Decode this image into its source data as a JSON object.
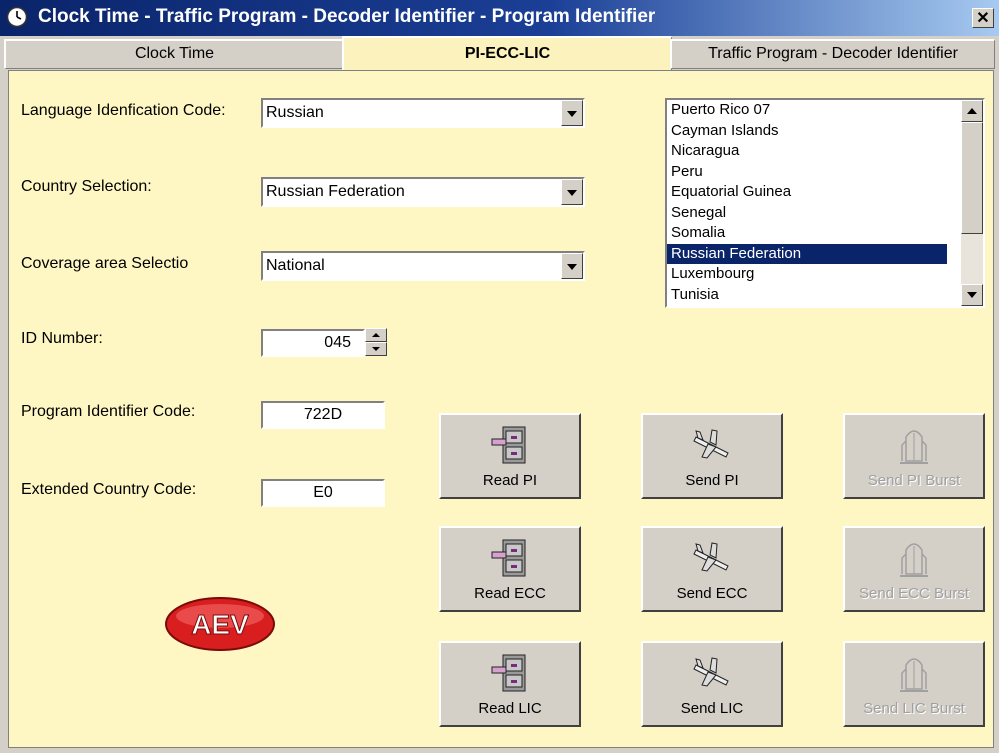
{
  "window": {
    "title": "Clock Time - Traffic Program - Decoder Identifier - Program Identifier",
    "close_glyph": "✕"
  },
  "tabs": [
    {
      "label": "Clock Time"
    },
    {
      "label": "PI-ECC-LIC",
      "active": true
    },
    {
      "label": "Traffic Program - Decoder Identifier"
    }
  ],
  "form": {
    "language_label": "Language Idenfication Code:",
    "language_value": "Russian",
    "country_label": "Country Selection:",
    "country_value": "Russian Federation",
    "coverage_label": "Coverage area Selectio",
    "coverage_value": "National",
    "id_label": "ID Number:",
    "id_value": "045",
    "pi_label": "Program Identifier Code:",
    "pi_value": "722D",
    "ecc_label": "Extended Country Code:",
    "ecc_value": "E0"
  },
  "country_list": {
    "items": [
      "Puerto Rico 07",
      "Cayman Islands",
      "Nicaragua",
      "Peru",
      "Equatorial Guinea",
      "Senegal",
      "Somalia",
      "Russian Federation",
      "Luxembourg",
      "Tunisia"
    ],
    "selected": "Russian Federation"
  },
  "buttons": {
    "read_pi": "Read PI",
    "send_pi": "Send PI",
    "send_pi_burst": "Send PI Burst",
    "read_ecc": "Read ECC",
    "send_ecc": "Send ECC",
    "send_ecc_burst": "Send ECC Burst",
    "read_lic": "Read LIC",
    "send_lic": "Send LIC",
    "send_lic_burst": "Send LIC Burst"
  },
  "icons": {
    "read": "file-cabinet-icon",
    "send": "airplane-icon",
    "burst": "space-shuttle-icon",
    "logo": "aev-logo"
  },
  "logo_text": "AEV",
  "colors": {
    "panel_bg": "#fff7c3",
    "title_gradient_start": "#0a246a",
    "selection": "#0a246a",
    "logo_red": "#d81e1e"
  }
}
